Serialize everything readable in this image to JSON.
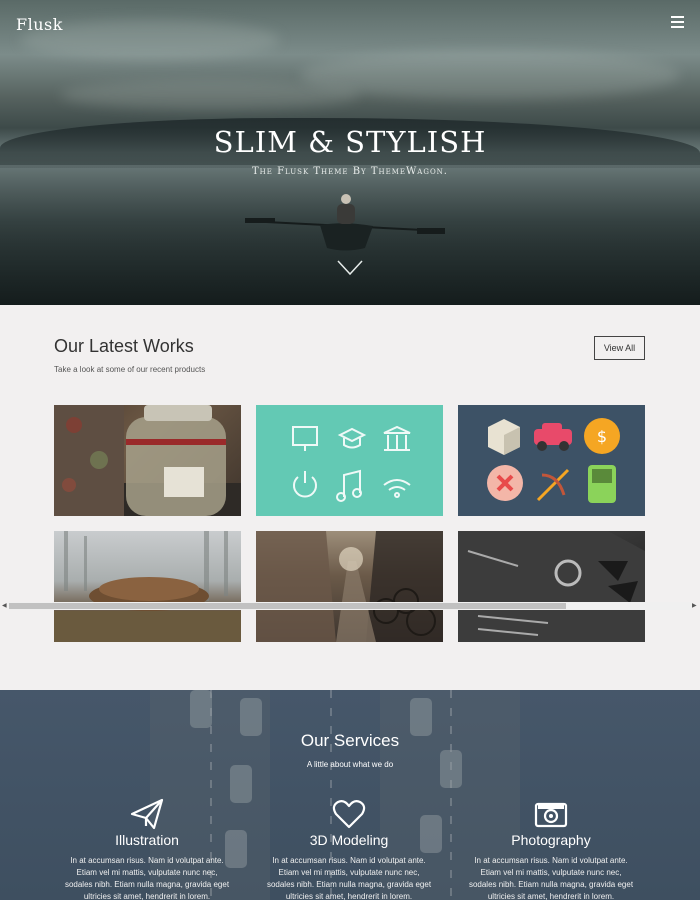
{
  "header": {
    "brand": "Flusk",
    "menu_icon": "hamburger-icon"
  },
  "hero": {
    "title": "SLIM & STYLISH",
    "subtitle": "The Flusk Theme By ThemeWagon.",
    "scroll_icon": "chevron-down-icon"
  },
  "works": {
    "title": "Our Latest Works",
    "subtitle": "Take a look at some of our recent products",
    "view_all_label": "View All",
    "tiles": [
      {
        "name": "jar-photo"
      },
      {
        "name": "flat-icons-teal"
      },
      {
        "name": "flat-icons-navy"
      },
      {
        "name": "woodpile-forest-photo"
      },
      {
        "name": "street-bikes-photo"
      },
      {
        "name": "business-card-photo"
      }
    ]
  },
  "services": {
    "title": "Our Services",
    "subtitle": "A little about what we do",
    "items": [
      {
        "icon": "paper-plane-icon",
        "name": "Illustration",
        "text": "In at accumsan risus. Nam id volutpat ante. Etiam vel mi mattis, vulputate nunc nec, sodales nibh. Etiam nulla magna, gravida eget ultricies sit amet, hendrerit in lorem."
      },
      {
        "icon": "heart-icon",
        "name": "3D Modeling",
        "text": "In at accumsan risus. Nam id volutpat ante. Etiam vel mi mattis, vulputate nunc nec, sodales nibh. Etiam nulla magna, gravida eget ultricies sit amet, hendrerit in lorem."
      },
      {
        "icon": "camera-icon",
        "name": "Photography",
        "text": "In at accumsan risus. Nam id volutpat ante. Etiam vel mi mattis, vulputate nunc nec, sodales nibh. Etiam nulla magna, gravida eget ultricies sit amet, hendrerit in lorem."
      }
    ]
  },
  "colors": {
    "teal_tile": "#63c9b4",
    "navy_tile": "#3d5266",
    "services_bg": "#46576a"
  }
}
